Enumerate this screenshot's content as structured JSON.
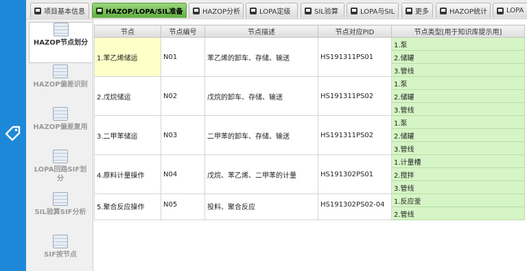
{
  "tabs": [
    {
      "label": "项目基本信息",
      "active": false
    },
    {
      "label": "HAZOP/LOPA/SIL准备",
      "active": true
    },
    {
      "label": "HAZOP分析",
      "active": false
    },
    {
      "label": "LOPA定级",
      "active": false
    },
    {
      "label": "SIL验算",
      "active": false
    },
    {
      "label": "LOPA与SIL",
      "active": false
    },
    {
      "label": "更多",
      "active": false
    },
    {
      "label": "HAZOP统计",
      "active": false
    },
    {
      "label": "LOPA",
      "active": false
    }
  ],
  "sidebar": [
    {
      "label": "HAZOP节点划分",
      "active": true
    },
    {
      "label": "HAZOP偏差识别",
      "active": false
    },
    {
      "label": "HAZOP偏差复用",
      "active": false
    },
    {
      "label": "LOPA回路SIF划分",
      "active": false
    },
    {
      "label": "SIL验算SIF分析",
      "active": false
    },
    {
      "label": "SIF按节点",
      "active": false
    }
  ],
  "table": {
    "headers": [
      "节点",
      "节点编号",
      "节点描述",
      "节点对应PID",
      "节点类型[用于知识库提示用]"
    ],
    "rows": [
      {
        "node": "1.苯乙烯储运",
        "code": "N01",
        "desc": "苯乙烯的卸车、存储、输送",
        "pid": "HS191311PS01",
        "types": [
          "1.泵",
          "2.储罐",
          "3.管线"
        ]
      },
      {
        "node": "2.戊烷储运",
        "code": "N02",
        "desc": "戊烷的卸车、存储、输送",
        "pid": "HS191311PS02",
        "types": [
          "1.泵",
          "2.储罐",
          "3.管线"
        ]
      },
      {
        "node": "3.二甲苯储运",
        "code": "N03",
        "desc": "二甲苯的卸车、存储、输送",
        "pid": "HS191311PS02",
        "types": [
          "1.泵",
          "2.储罐",
          "3.管线"
        ]
      },
      {
        "node": "4.原料计量操作",
        "code": "N04",
        "desc": "戊烷、苯乙烯、二甲苯的计量",
        "pid": "HS191302PS01",
        "types": [
          "1.计量槽",
          "2.搅拌",
          "3.管线"
        ]
      },
      {
        "node": "5.聚合反应操作",
        "code": "N05",
        "desc": "投料、聚合反应",
        "pid": "HS191302PS02-04",
        "types": [
          "1.反应釜",
          "2.管线"
        ]
      }
    ]
  },
  "icons": {
    "rail": "tag-icon",
    "tab": "tab-icon",
    "side": "table-icon"
  },
  "colors": {
    "frame": "#1e88d8",
    "active_tab": "#6db84b",
    "type_cell": "#d6f5c6",
    "selected_cell": "#ffffc8"
  }
}
